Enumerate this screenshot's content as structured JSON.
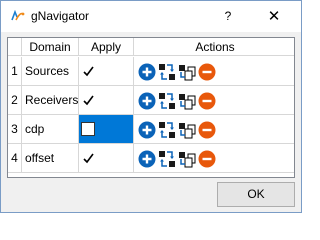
{
  "window": {
    "title": "gNavigator",
    "help_label": "?",
    "close_label": "✕"
  },
  "table": {
    "headers": [
      "Domain",
      "Apply",
      "Actions"
    ],
    "rows": [
      {
        "num": "1",
        "domain": "Sources",
        "apply": true
      },
      {
        "num": "2",
        "domain": "Receivers",
        "apply": true
      },
      {
        "num": "3",
        "domain": "cdp",
        "apply": false,
        "editing": true
      },
      {
        "num": "4",
        "domain": "offset",
        "apply": true
      }
    ],
    "action_icons": [
      "add-icon",
      "swap-icon",
      "copy-icon",
      "remove-icon"
    ]
  },
  "footer": {
    "ok_label": "OK"
  },
  "colors": {
    "selection": "#0078d7",
    "add": "#0b63b8",
    "remove": "#e8580b"
  }
}
